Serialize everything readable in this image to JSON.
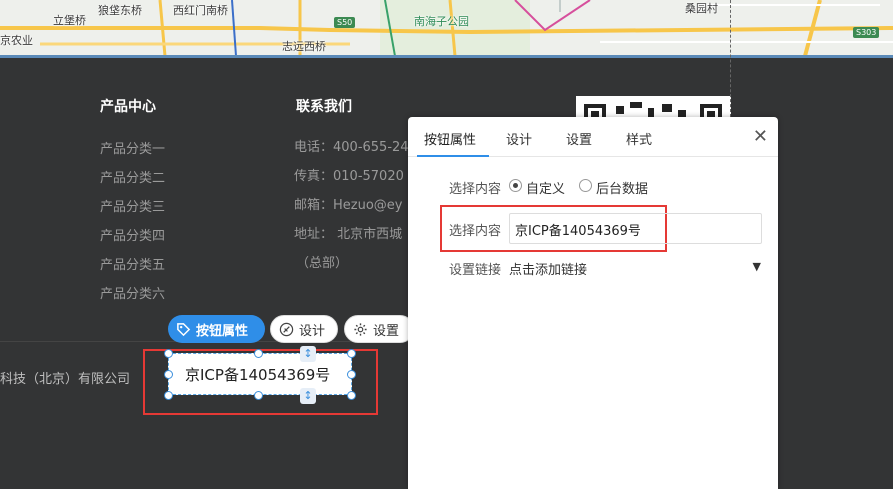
{
  "map": {
    "labels": [
      "立堡桥",
      "狼垡东桥",
      "西红门南桥",
      "南海子公园",
      "桑园村",
      "京农业",
      "志远西桥"
    ],
    "road_badges": [
      "S50",
      "S303"
    ]
  },
  "footer": {
    "columns": [
      {
        "title": "产品中心",
        "items": [
          "产品分类一",
          "产品分类二",
          "产品分类三",
          "产品分类四",
          "产品分类五",
          "产品分类六"
        ]
      },
      {
        "title": "联系我们",
        "items": [
          "电话：400-655-24",
          "传真：010-57020",
          "邮箱：Hezuo@ey",
          "地址： 北京市西城",
          "（总部）"
        ]
      }
    ],
    "company": "科技（北京）有限公司"
  },
  "toolbar": {
    "button_props_label": "按钮属性",
    "design_label": "设计",
    "settings_label": "设置"
  },
  "selected_element": {
    "text": "京ICP备14054369号"
  },
  "panel": {
    "tabs": [
      "按钮属性",
      "设计",
      "设置",
      "样式"
    ],
    "active_tab": 0,
    "select_content_label": "选择内容",
    "radio_options": [
      "自定义",
      "后台数据"
    ],
    "radio_selected": 0,
    "content_input_label": "选择内容",
    "content_input_value": "京ICP备14054369号",
    "link_label": "设置链接",
    "link_value": "点击添加链接"
  },
  "colors": {
    "accent": "#2f8ee8",
    "highlight": "#e53935",
    "footer_bg": "#333435"
  }
}
